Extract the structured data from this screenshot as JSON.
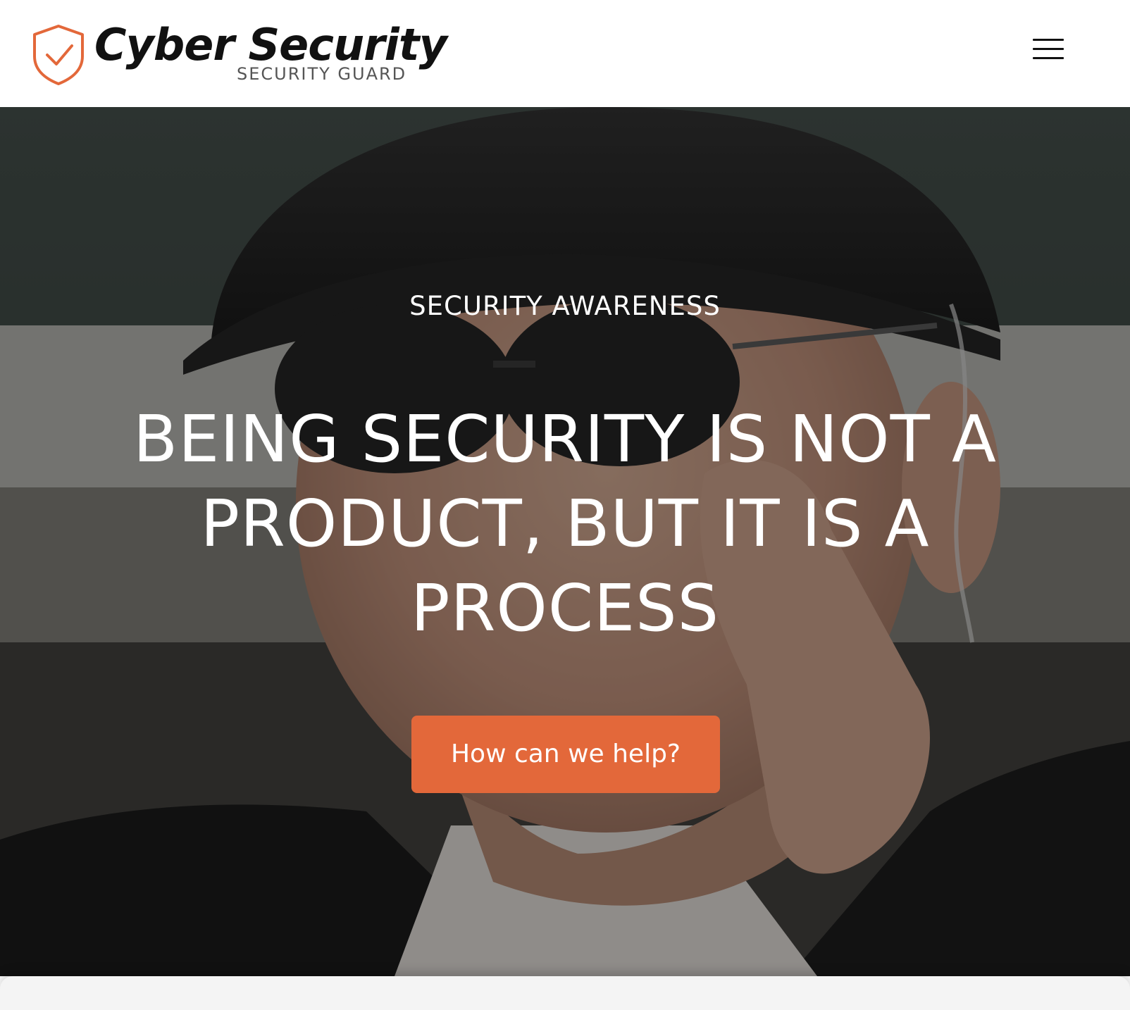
{
  "brand": {
    "title": "Cyber Security",
    "subtitle": "SECURITY GUARD",
    "shield_icon": "shield-check-icon",
    "accent_color": "#e3683a"
  },
  "header": {
    "menu_icon": "hamburger-menu-icon"
  },
  "hero": {
    "eyebrow": "SECURITY AWARENESS",
    "heading": "BEING SECURITY IS NOT A PRODUCT, BUT IT IS A PROCESS",
    "cta_label": "How can we help?"
  }
}
